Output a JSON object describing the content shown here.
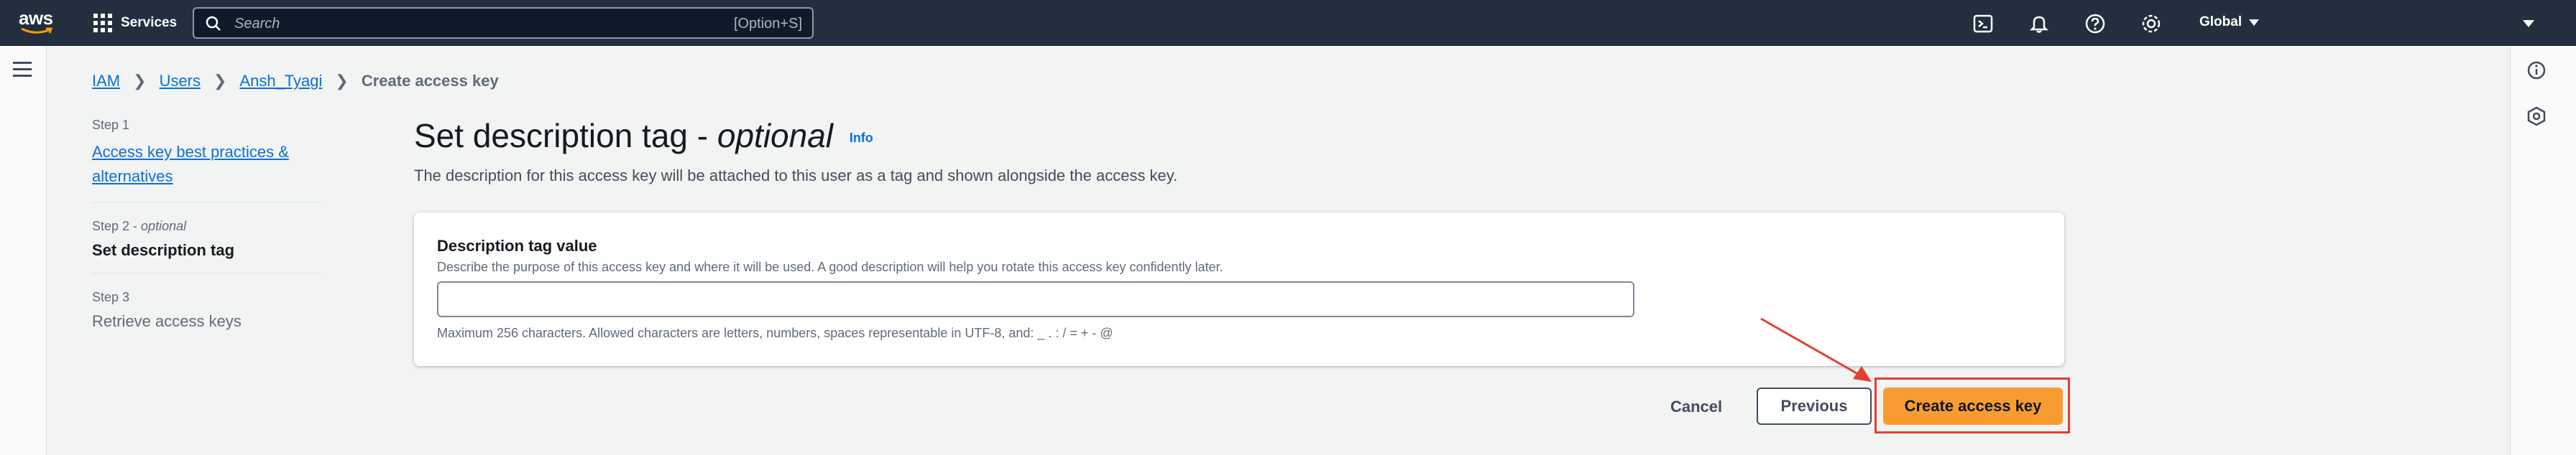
{
  "topnav": {
    "logo_text": "aws",
    "services_label": "Services",
    "search_placeholder": "Search",
    "search_shortcut": "[Option+S]",
    "region_label": "Global",
    "icons": [
      "cloudshell-icon",
      "notifications-icon",
      "help-icon",
      "settings-icon"
    ]
  },
  "breadcrumb": {
    "items": [
      {
        "label": "IAM"
      },
      {
        "label": "Users"
      },
      {
        "label": "Ansh_Tyagi"
      }
    ],
    "current": "Create access key"
  },
  "steps": [
    {
      "number": "Step 1",
      "label": "Access key best practices & alternatives",
      "state": "completed"
    },
    {
      "number": "Step 2",
      "qualifier": "optional",
      "label": "Set description tag",
      "state": "current"
    },
    {
      "number": "Step 3",
      "label": "Retrieve access keys",
      "state": "upcoming"
    }
  ],
  "main": {
    "title": "Set description tag -",
    "title_optional": "optional",
    "info_link": "Info",
    "description": "The description for this access key will be attached to this user as a tag and shown alongside the access key."
  },
  "form": {
    "field_label": "Description tag value",
    "field_hint": "Describe the purpose of this access key and where it will be used. A good description will help you rotate this access key confidently later.",
    "field_value": "",
    "field_constraint": "Maximum 256 characters. Allowed characters are letters, numbers, spaces representable in UTF-8, and: _ . : / = + - @"
  },
  "actions": {
    "cancel": "Cancel",
    "previous": "Previous",
    "create": "Create access key"
  },
  "colors": {
    "nav_bg": "#232f3e",
    "link": "#0972d3",
    "primary_button": "#f89c32",
    "annotation": "#e53e31"
  }
}
